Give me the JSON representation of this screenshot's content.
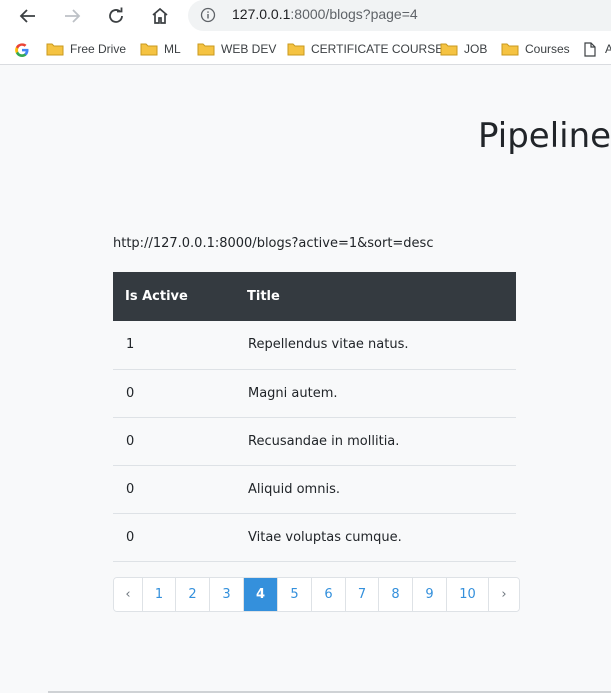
{
  "browser": {
    "url_host": "127.0.0.1",
    "url_rest": ":8000/blogs?page=4"
  },
  "bookmarks": [
    {
      "label": "Free Drive"
    },
    {
      "label": "ML"
    },
    {
      "label": "WEB DEV"
    },
    {
      "label": "CERTIFICATE COURSE"
    },
    {
      "label": "JOB"
    },
    {
      "label": "Courses"
    },
    {
      "label": "A"
    }
  ],
  "page": {
    "title": "Pipeline",
    "filter_url": "http://127.0.0.1:8000/blogs?active=1&sort=desc"
  },
  "table": {
    "headers": [
      "Is Active",
      "Title"
    ],
    "rows": [
      [
        "1",
        "Repellendus vitae natus."
      ],
      [
        "0",
        "Magni autem."
      ],
      [
        "0",
        "Recusandae in mollitia."
      ],
      [
        "0",
        "Aliquid omnis."
      ],
      [
        "0",
        "Vitae voluptas cumque."
      ]
    ]
  },
  "pagination": {
    "prev": "‹",
    "next": "›",
    "pages": [
      "1",
      "2",
      "3",
      "4",
      "5",
      "6",
      "7",
      "8",
      "9",
      "10"
    ],
    "current": "4"
  },
  "colors": {
    "accent": "#3490dc",
    "table_header": "#343a40",
    "page_bg": "#f8f9fa",
    "folder": "#f5c342"
  }
}
